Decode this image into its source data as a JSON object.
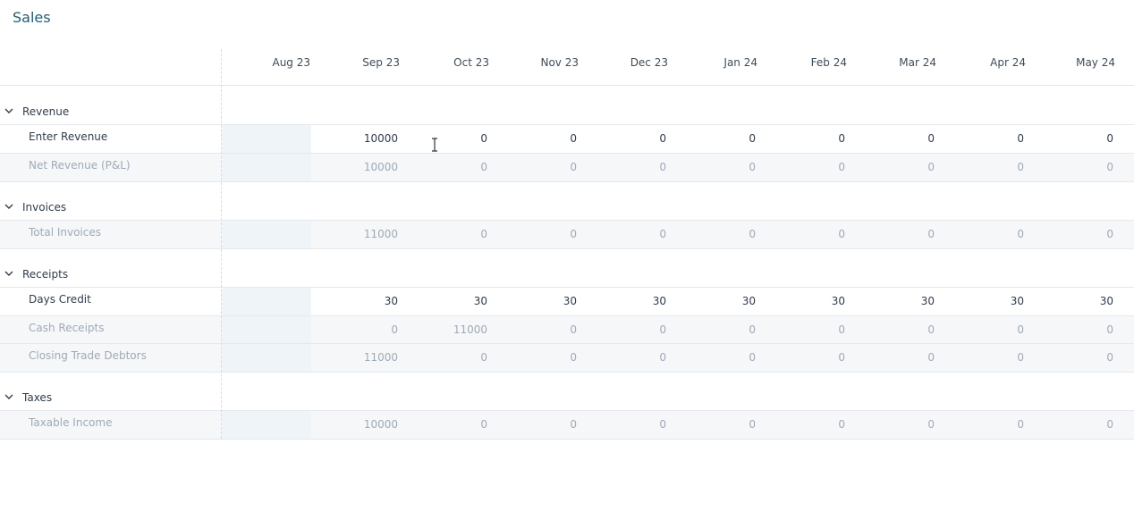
{
  "title": "Sales",
  "months": [
    "Aug 23",
    "Sep 23",
    "Oct 23",
    "Nov 23",
    "Dec 23",
    "Jan 24",
    "Feb 24",
    "Mar 24",
    "Apr 24",
    "May 24"
  ],
  "sections": [
    {
      "label": "Revenue",
      "rows": [
        {
          "label": "Enter Revenue",
          "type": "editable",
          "values": [
            "",
            "10000",
            "0",
            "0",
            "0",
            "0",
            "0",
            "0",
            "0",
            "0"
          ]
        },
        {
          "label": "Net Revenue (P&L)",
          "type": "calc",
          "values": [
            "",
            "10000",
            "0",
            "0",
            "0",
            "0",
            "0",
            "0",
            "0",
            "0"
          ]
        }
      ]
    },
    {
      "label": "Invoices",
      "rows": [
        {
          "label": "Total Invoices",
          "type": "calc",
          "values": [
            "",
            "11000",
            "0",
            "0",
            "0",
            "0",
            "0",
            "0",
            "0",
            "0"
          ]
        }
      ]
    },
    {
      "label": "Receipts",
      "rows": [
        {
          "label": "Days Credit",
          "type": "editable",
          "values": [
            "",
            "30",
            "30",
            "30",
            "30",
            "30",
            "30",
            "30",
            "30",
            "30"
          ]
        },
        {
          "label": "Cash Receipts",
          "type": "calc",
          "values": [
            "",
            "0",
            "11000",
            "0",
            "0",
            "0",
            "0",
            "0",
            "0",
            "0"
          ]
        },
        {
          "label": "Closing Trade Debtors",
          "type": "calc",
          "values": [
            "",
            "11000",
            "0",
            "0",
            "0",
            "0",
            "0",
            "0",
            "0",
            "0"
          ]
        }
      ]
    },
    {
      "label": "Taxes",
      "rows": [
        {
          "label": "Taxable Income",
          "type": "calc",
          "values": [
            "",
            "10000",
            "0",
            "0",
            "0",
            "0",
            "0",
            "0",
            "0",
            "0"
          ]
        }
      ]
    }
  ],
  "icons": {
    "chevron": "chevron-down-icon",
    "cursor": "text-cursor-icon"
  }
}
